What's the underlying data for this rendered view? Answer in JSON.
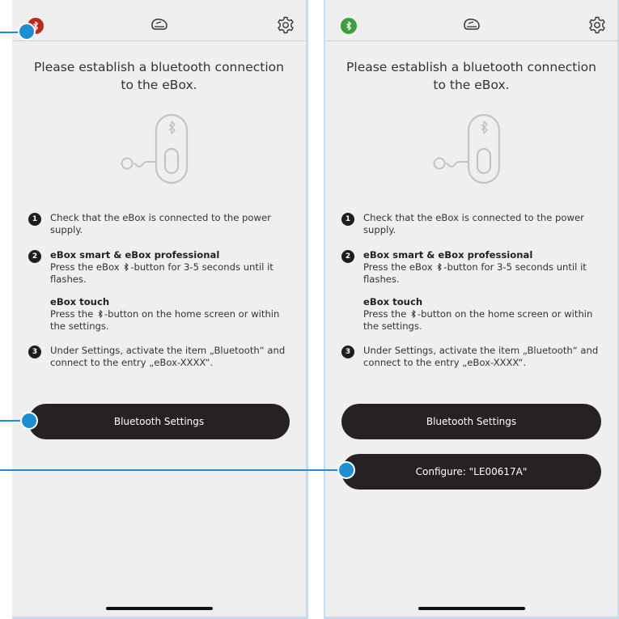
{
  "screens": [
    {
      "id": "disconnected",
      "bt_status_color": "#b72b1c",
      "heading": "Please establish a bluetooth connection to the eBox.",
      "steps": {
        "step1": {
          "num": "1",
          "text": "Check that the eBox is connected to the power supply."
        },
        "step2": {
          "num": "2",
          "title": "eBox smart & eBox professional",
          "text_before": "Press the eBox ",
          "text_after": "-button for 3-5 seconds until it flashes."
        },
        "step2b": {
          "title": "eBox touch",
          "text_before": "Press the ",
          "text_after": "-button on the home screen or within the settings."
        },
        "step3": {
          "num": "3",
          "text": "Under Settings, activate the item „Bluetooth“ and connect to the entry „eBox-XXXX“."
        }
      },
      "bluetooth_settings_label": "Bluetooth Settings"
    },
    {
      "id": "connected",
      "bt_status_color": "#3b9f3d",
      "heading": "Please establish a bluetooth connection to the eBox.",
      "steps": {
        "step1": {
          "num": "1",
          "text": "Check that the eBox is connected to the power supply."
        },
        "step2": {
          "num": "2",
          "title": "eBox smart & eBox professional",
          "text_before": "Press the eBox ",
          "text_after": "-button for 3-5 seconds until it flashes."
        },
        "step2b": {
          "title": "eBox touch",
          "text_before": "Press the ",
          "text_after": "-button on the home screen or within the settings."
        },
        "step3": {
          "num": "3",
          "text": "Under Settings, activate the item „Bluetooth“ and connect to the entry „eBox-XXXX“."
        }
      },
      "bluetooth_settings_label": "Bluetooth Settings",
      "configure_label": "Configure: \"LE00617A\""
    }
  ],
  "icons": {
    "status": "bluetooth-icon",
    "header": "car-icon",
    "settings": "gear-icon",
    "illustration": "ebox-device-icon"
  },
  "accent_color": "#1c8ed1"
}
